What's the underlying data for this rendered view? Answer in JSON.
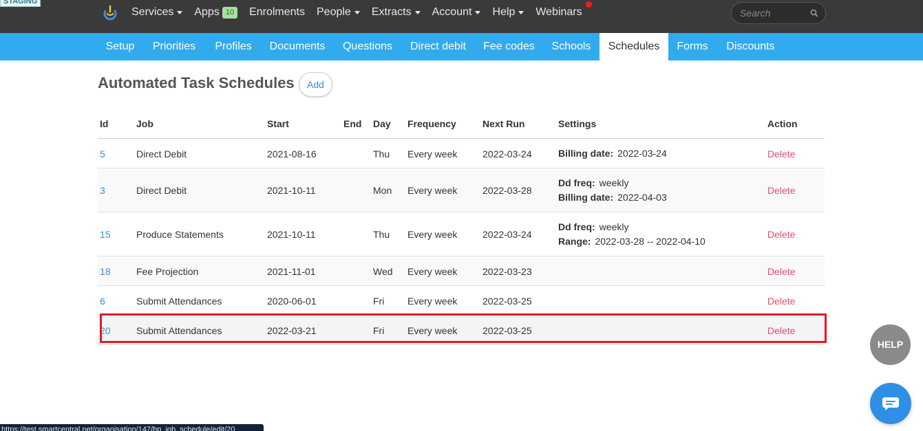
{
  "env_badge": "STAGING",
  "topnav": {
    "items": [
      {
        "label": "Services",
        "dropdown": true
      },
      {
        "label": "Apps",
        "badge": "10"
      },
      {
        "label": "Enrolments"
      },
      {
        "label": "People",
        "dropdown": true
      },
      {
        "label": "Extracts",
        "dropdown": true
      },
      {
        "label": "Account",
        "dropdown": true
      },
      {
        "label": "Help",
        "dropdown": true
      },
      {
        "label": "Webinars"
      }
    ],
    "search_placeholder": "Search"
  },
  "subnav": {
    "items": [
      "Setup",
      "Priorities",
      "Profiles",
      "Documents",
      "Questions",
      "Direct debit",
      "Fee codes",
      "Schools",
      "Schedules",
      "Forms",
      "Discounts"
    ],
    "active": "Schedules"
  },
  "page": {
    "title": "Automated Task Schedules",
    "add_label": "Add"
  },
  "table": {
    "columns": [
      "Id",
      "Job",
      "Start",
      "End",
      "Day",
      "Frequency",
      "Next Run",
      "Settings",
      "Action"
    ],
    "rows": [
      {
        "id": "5",
        "job": "Direct Debit",
        "start": "2021-08-16",
        "end": "",
        "day": "Thu",
        "frequency": "Every week",
        "next_run": "2022-03-24",
        "settings": [
          {
            "key": "Billing date:",
            "value": "2022-03-24"
          }
        ],
        "action": "Delete"
      },
      {
        "id": "3",
        "job": "Direct Debit",
        "start": "2021-10-11",
        "end": "",
        "day": "Mon",
        "frequency": "Every week",
        "next_run": "2022-03-28",
        "settings": [
          {
            "key": "Dd freq:",
            "value": "weekly"
          },
          {
            "key": "Billing date:",
            "value": "2022-04-03"
          }
        ],
        "action": "Delete"
      },
      {
        "id": "15",
        "job": "Produce Statements",
        "start": "2021-10-11",
        "end": "",
        "day": "Thu",
        "frequency": "Every week",
        "next_run": "2022-03-24",
        "settings": [
          {
            "key": "Dd freq:",
            "value": "weekly"
          },
          {
            "key": "Range:",
            "value": "2022-03-28 -- 2022-04-10"
          }
        ],
        "action": "Delete"
      },
      {
        "id": "18",
        "job": "Fee Projection",
        "start": "2021-11-01",
        "end": "",
        "day": "Wed",
        "frequency": "Every week",
        "next_run": "2022-03-23",
        "settings": [],
        "action": "Delete"
      },
      {
        "id": "6",
        "job": "Submit Attendances",
        "start": "2020-06-01",
        "end": "",
        "day": "Fri",
        "frequency": "Every week",
        "next_run": "2022-03-25",
        "settings": [],
        "action": "Delete"
      },
      {
        "id": "20",
        "job": "Submit Attendances",
        "start": "2022-03-21",
        "end": "",
        "day": "Fri",
        "frequency": "Every week",
        "next_run": "2022-03-25",
        "settings": [],
        "action": "Delete"
      }
    ]
  },
  "help_label": "HELP",
  "status_url": "https://test.smartcentral.net/organisation/147/bp_job_schedule/edit/20"
}
